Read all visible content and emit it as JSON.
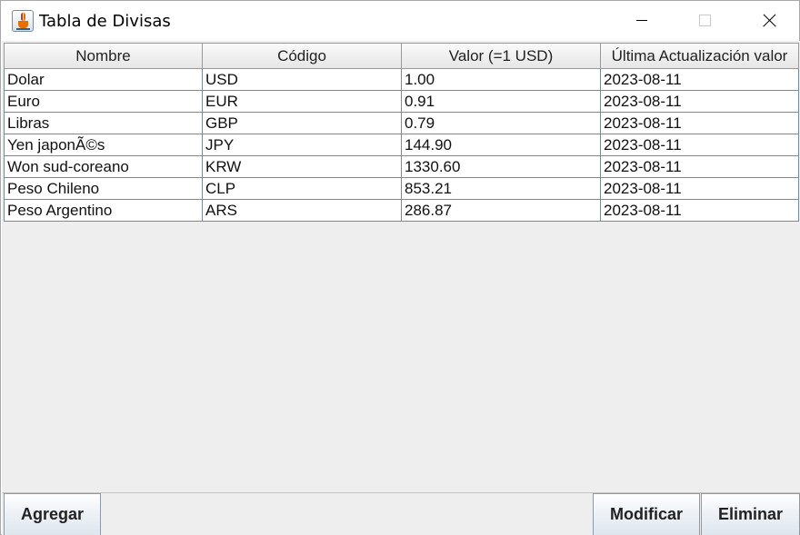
{
  "window": {
    "title": "Tabla de Divisas"
  },
  "table": {
    "columns": [
      "Nombre",
      "Código",
      "Valor (=1 USD)",
      "Última Actualización valor"
    ],
    "rows": [
      [
        "Dolar",
        "USD",
        "1.00",
        "2023-08-11"
      ],
      [
        "Euro",
        "EUR",
        "0.91",
        "2023-08-11"
      ],
      [
        "Libras",
        "GBP",
        "0.79",
        "2023-08-11"
      ],
      [
        "Yen japonÃ©s",
        "JPY",
        "144.90",
        "2023-08-11"
      ],
      [
        "Won sud-coreano",
        "KRW",
        "1330.60",
        "2023-08-11"
      ],
      [
        "Peso Chileno",
        "CLP",
        "853.21",
        "2023-08-11"
      ],
      [
        "Peso Argentino",
        "ARS",
        "286.87",
        "2023-08-11"
      ]
    ]
  },
  "buttons": {
    "add": "Agregar",
    "modify": "Modificar",
    "delete": "Eliminar"
  },
  "icons": {
    "app": "java-cup-icon",
    "minimize": "minimize-icon",
    "maximize": "maximize-icon",
    "close": "close-icon"
  }
}
